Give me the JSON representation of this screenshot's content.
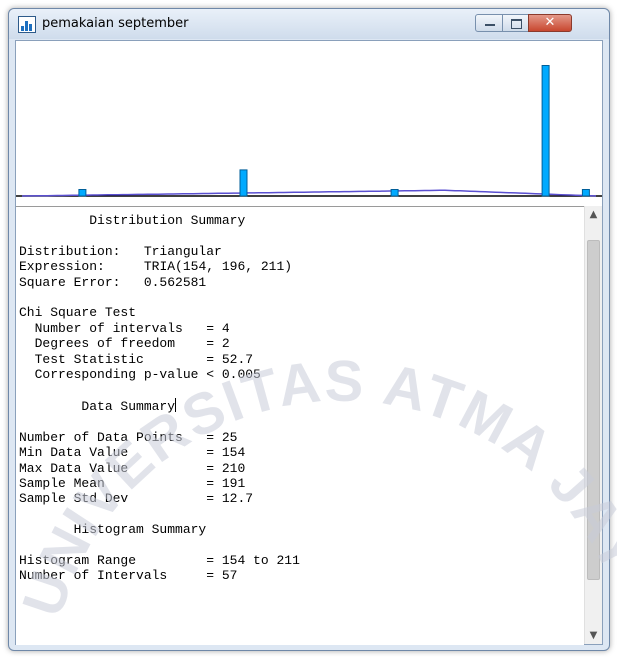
{
  "window": {
    "title": "pemakaian september",
    "controls": {
      "minimize": "—",
      "maximize": "☐",
      "close": "✕"
    }
  },
  "chart_data": {
    "type": "bar",
    "title": "",
    "xlabel": "",
    "ylabel": "",
    "xlim": [
      154,
      211
    ],
    "x": [
      160,
      176,
      191,
      206,
      210
    ],
    "values": [
      1,
      4,
      1,
      20,
      1
    ],
    "ylim": [
      0,
      21
    ],
    "bar_color": "#00aaff",
    "fit": {
      "type": "triangular",
      "a": 154,
      "c": 196,
      "b": 211,
      "color": "#5a4fd0"
    }
  },
  "summary": {
    "dist_header": "Distribution Summary",
    "distribution_label": "Distribution:",
    "distribution_value": "Triangular",
    "expression_label": "Expression:",
    "expression_value": "TRIA(154, 196, 211)",
    "square_error_label": "Square Error:",
    "square_error_value": "0.562581",
    "chi_header": "Chi Square Test",
    "intervals_label": "Number of intervals",
    "intervals_value": "= 4",
    "dof_label": "Degrees of freedom",
    "dof_value": "= 2",
    "test_stat_label": "Test Statistic",
    "test_stat_value": "= 52.7",
    "pvalue_label": "Corresponding p-value",
    "pvalue_value": "< 0.005",
    "data_header": "Data Summary",
    "points_label": "Number of Data Points",
    "points_value": "= 25",
    "min_label": "Min Data Value",
    "min_value": "= 154",
    "max_label": "Max Data Value",
    "max_value": "= 210",
    "mean_label": "Sample Mean",
    "mean_value": "= 191",
    "std_label": "Sample Std Dev",
    "std_value": "= 12.7",
    "hist_header": "Histogram Summary",
    "range_label": "Histogram Range",
    "range_value": "= 154 to 211",
    "hist_intervals_label": "Number of Intervals",
    "hist_intervals_value": "= 57"
  },
  "scrollbar": {
    "up": "▲",
    "down": "▼"
  },
  "watermark": {
    "text": "UNIVERSITAS ATMA JAYA YOGYAKARTA",
    "color": "#c9ccd8"
  }
}
